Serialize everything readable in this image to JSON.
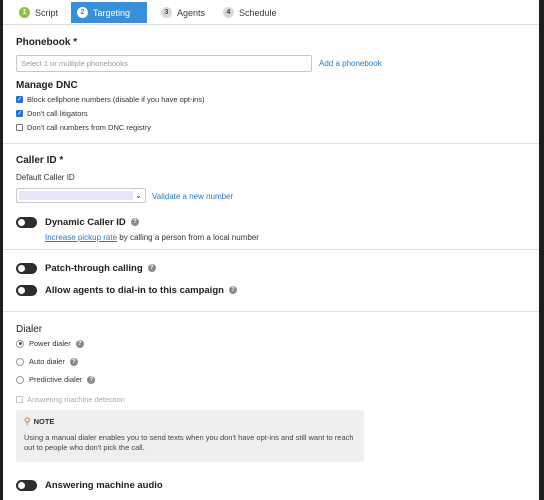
{
  "tabs": [
    {
      "num": "1",
      "label": "Script"
    },
    {
      "num": "2",
      "label": "Targeting"
    },
    {
      "num": "3",
      "label": "Agents"
    },
    {
      "num": "4",
      "label": "Schedule"
    }
  ],
  "phonebook": {
    "heading": "Phonebook *",
    "placeholder": "Select 1 or multiple phonebooks",
    "add_link": "Add a phonebook"
  },
  "dnc": {
    "heading": "Manage DNC",
    "options": [
      {
        "label": "Block cellphone numbers (disable if you have opt-ins)",
        "checked": true
      },
      {
        "label": "Don't call litigators",
        "checked": true
      },
      {
        "label": "Don't call numbers from DNC registry",
        "checked": false
      }
    ]
  },
  "caller_id": {
    "heading": "Caller ID *",
    "sublabel": "Default Caller ID",
    "validate_link": "Validate a new number"
  },
  "dynamic_caller_id": {
    "label": "Dynamic Caller ID",
    "link": "Increase pickup rate",
    "rest": " by calling a person from a local number"
  },
  "toggles": {
    "patch_through": "Patch-through calling",
    "dial_in": "Allow agents to dial-in to this campaign",
    "answering_audio": "Answering machine audio"
  },
  "dialer": {
    "heading": "Dialer",
    "options": [
      {
        "label": "Power dialer",
        "selected": true
      },
      {
        "label": "Auto dialer",
        "selected": false
      },
      {
        "label": "Predictive dialer",
        "selected": false
      }
    ],
    "amd_label": "Answering machine detection"
  },
  "note": {
    "title": "NOTE",
    "text": "Using a manual dialer enables you to send texts when you don't have opt-ins and still want to reach out to people who don't pick the call."
  },
  "colors": {
    "accent": "#3a8fd9",
    "done": "#8ec04b",
    "link": "#2a7ac3"
  }
}
